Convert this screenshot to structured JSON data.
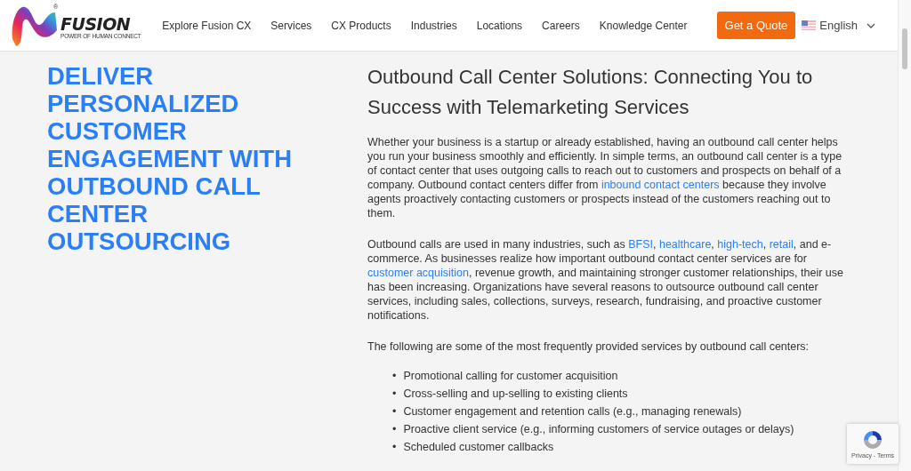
{
  "header": {
    "logo": {
      "name": "FUSION",
      "tagline": "POWER OF HUMAN CONNECT",
      "mark": "®"
    },
    "nav": [
      {
        "label": "Explore Fusion CX"
      },
      {
        "label": "Services"
      },
      {
        "label": "CX Products"
      },
      {
        "label": "Industries"
      },
      {
        "label": "Locations"
      },
      {
        "label": "Careers"
      },
      {
        "label": "Knowledge Center"
      }
    ],
    "cta": "Get a Quote",
    "language": "English"
  },
  "hero_heading": "DELIVER PERSONALIZED CUSTOMER ENGAGEMENT WITH OUTBOUND CALL CENTER OUTSOURCING",
  "article": {
    "title": "Outbound Call Center Solutions: Connecting You to Success with Telemarketing Services",
    "paragraphs": [
      [
        {
          "kind": "text",
          "text": "Whether your business is a startup or already established, having an outbound call center helps you run your business smoothly and efficiently. In simple terms, an outbound call center is a type of contact center that uses outgoing calls to reach out to customers and prospects on behalf of a company. Outbound contact centers differ from "
        },
        {
          "kind": "link",
          "text": "inbound contact centers"
        },
        {
          "kind": "text",
          "text": " because they involve agents proactively contacting customers or prospects instead of the customers reaching out to them."
        }
      ],
      [
        {
          "kind": "text",
          "text": "Outbound calls are used in many industries, such as "
        },
        {
          "kind": "link",
          "text": "BFSI"
        },
        {
          "kind": "text",
          "text": ", "
        },
        {
          "kind": "link",
          "text": "healthcare"
        },
        {
          "kind": "text",
          "text": ", "
        },
        {
          "kind": "link",
          "text": "high-tech"
        },
        {
          "kind": "text",
          "text": ", "
        },
        {
          "kind": "link",
          "text": "retail"
        },
        {
          "kind": "text",
          "text": ", and e-commerce. As businesses realize how important outbound contact center services are for "
        },
        {
          "kind": "link",
          "text": "customer acquisition"
        },
        {
          "kind": "text",
          "text": ", revenue growth, and maintaining stronger customer relationships, their use has been increasing. Organizations have several reasons to outsource outbound call center services, including sales, collections, surveys, research, fundraising, and proactive customer notifications."
        }
      ],
      [
        {
          "kind": "text",
          "text": "The following are some of the most frequently provided services by outbound call centers:"
        }
      ]
    ],
    "bullets": [
      {
        "marker": "•",
        "text": "Promotional calling for customer acquisition"
      },
      {
        "marker": "•",
        "text": "Cross-selling and up-selling to existing clients"
      },
      {
        "marker": "•",
        "text": "Customer engagement and retention calls (e.g., managing renewals)"
      },
      {
        "marker": "•",
        "text": "Proactive client service (e.g., informing customers of service outages or delays)"
      },
      {
        "marker": "•",
        "text": "Scheduled customer callbacks"
      }
    ]
  },
  "recaptcha": {
    "links": "Privacy - Terms"
  }
}
